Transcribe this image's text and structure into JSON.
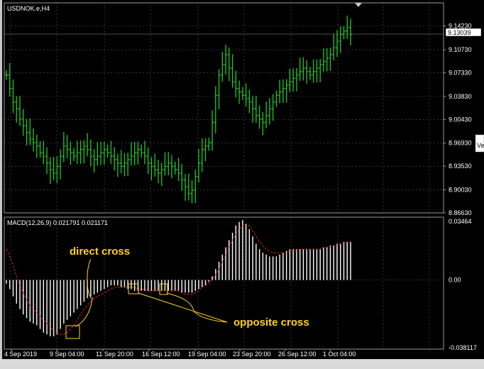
{
  "window": {
    "symbol_title": "USDNOK.e,H4",
    "indicator_title": "MACD(12,26,9) 0.021791 0.021171",
    "side_tab": "Ve"
  },
  "price_axis": {
    "labels": [
      "9.14230",
      "9.10730",
      "9.07330",
      "9.03830",
      "9.00430",
      "8.96930",
      "8.93530",
      "8.90030",
      "8.86630"
    ],
    "current_price": "9.13039"
  },
  "macd_axis": {
    "labels": [
      "0.03464",
      "0.00",
      "-0.038117"
    ]
  },
  "time_axis": {
    "labels": [
      "4 Sep 2019",
      "9 Sep 04:00",
      "11 Sep 20:00",
      "16 Sep 12:00",
      "19 Sep 04:00",
      "23 Sep 20:00",
      "26 Sep 12:00",
      "1 Oct 04:00"
    ]
  },
  "annotations": {
    "direct_cross": "direct cross",
    "opposite_cross": "opposite cross"
  },
  "colors": {
    "background": "#000000",
    "bars": "#22c72a",
    "histogram": "#ffffff",
    "signal": "#e02020",
    "annotation": "#ffd21a",
    "grid": "#555555"
  },
  "chart_data": [
    {
      "type": "ohlc",
      "title": "USDNOK.e,H4",
      "ylim": [
        8.8663,
        9.1765
      ],
      "x": [
        "4 Sep 2019",
        "9 Sep 04:00",
        "11 Sep 20:00",
        "16 Sep 12:00",
        "19 Sep 04:00",
        "23 Sep 20:00",
        "26 Sep 12:00",
        "1 Oct 04:00"
      ],
      "closes": [
        9.07,
        9.05,
        9.03,
        9.02,
        9.005,
        8.995,
        8.985,
        8.975,
        8.97,
        8.965,
        8.955,
        8.95,
        8.94,
        8.93,
        8.925,
        8.935,
        8.95,
        8.965,
        8.96,
        8.955,
        8.95,
        8.955,
        8.96,
        8.965,
        8.96,
        8.95,
        8.945,
        8.95,
        8.955,
        8.96,
        8.955,
        8.95,
        8.945,
        8.94,
        8.935,
        8.94,
        8.945,
        8.95,
        8.955,
        8.96,
        8.955,
        8.95,
        8.94,
        8.935,
        8.93,
        8.925,
        8.93,
        8.935,
        8.94,
        8.935,
        8.93,
        8.925,
        8.915,
        8.905,
        8.895,
        8.9,
        8.92,
        8.94,
        8.96,
        8.965,
        8.97,
        9.0,
        9.04,
        9.07,
        9.085,
        9.1,
        9.08,
        9.06,
        9.05,
        9.045,
        9.04,
        9.035,
        9.03,
        9.02,
        9.01,
        9.005,
        9.0,
        9.01,
        9.02,
        9.03,
        9.04,
        9.045,
        9.05,
        9.055,
        9.06,
        9.065,
        9.07,
        9.075,
        9.08,
        9.075,
        9.07,
        9.075,
        9.08,
        9.085,
        9.09,
        9.095,
        9.1,
        9.11,
        9.12,
        9.13,
        9.135,
        9.14,
        9.13
      ],
      "highs_delta": 0.018,
      "lows_delta": 0.018
    },
    {
      "type": "bar",
      "title": "MACD(12,26,9) 0.021791 0.021171",
      "ylim": [
        -0.038117,
        0.03464
      ],
      "series": [
        {
          "name": "MACD",
          "values": [
            -0.002,
            -0.005,
            -0.009,
            -0.013,
            -0.016,
            -0.019,
            -0.021,
            -0.023,
            -0.024,
            -0.025,
            -0.027,
            -0.029,
            -0.03,
            -0.031,
            -0.031,
            -0.03,
            -0.027,
            -0.024,
            -0.022,
            -0.02,
            -0.018,
            -0.016,
            -0.014,
            -0.012,
            -0.01,
            -0.009,
            -0.008,
            -0.007,
            -0.006,
            -0.005,
            -0.004,
            -0.003,
            -0.003,
            -0.003,
            -0.004,
            -0.004,
            -0.005,
            -0.005,
            -0.006,
            -0.006,
            -0.006,
            -0.006,
            -0.006,
            -0.006,
            -0.006,
            -0.006,
            -0.006,
            -0.006,
            -0.006,
            -0.006,
            -0.006,
            -0.006,
            -0.007,
            -0.007,
            -0.007,
            -0.007,
            -0.006,
            -0.005,
            -0.004,
            -0.003,
            -0.001,
            0.002,
            0.006,
            0.01,
            0.014,
            0.018,
            0.022,
            0.026,
            0.03,
            0.032,
            0.033,
            0.031,
            0.028,
            0.024,
            0.02,
            0.017,
            0.015,
            0.014,
            0.013,
            0.013,
            0.013,
            0.014,
            0.015,
            0.016,
            0.017,
            0.017,
            0.017,
            0.017,
            0.017,
            0.017,
            0.017,
            0.017,
            0.017,
            0.017,
            0.018,
            0.018,
            0.019,
            0.019,
            0.02,
            0.02,
            0.021,
            0.021,
            0.021
          ]
        },
        {
          "name": "Signal",
          "values": [
            0.017,
            0.013,
            0.008,
            0.002,
            -0.003,
            -0.007,
            -0.011,
            -0.014,
            -0.016,
            -0.018,
            -0.02,
            -0.022,
            -0.024,
            -0.026,
            -0.028,
            -0.029,
            -0.03,
            -0.03,
            -0.029,
            -0.027,
            -0.025,
            -0.022,
            -0.019,
            -0.016,
            -0.014,
            -0.012,
            -0.01,
            -0.009,
            -0.008,
            -0.007,
            -0.006,
            -0.005,
            -0.004,
            -0.004,
            -0.004,
            -0.004,
            -0.004,
            -0.004,
            -0.004,
            -0.005,
            -0.005,
            -0.005,
            -0.006,
            -0.006,
            -0.006,
            -0.006,
            -0.006,
            -0.006,
            -0.006,
            -0.006,
            -0.006,
            -0.006,
            -0.007,
            -0.008,
            -0.008,
            -0.008,
            -0.007,
            -0.006,
            -0.004,
            -0.003,
            -0.002,
            0.0,
            0.003,
            0.006,
            0.01,
            0.014,
            0.018,
            0.022,
            0.025,
            0.028,
            0.03,
            0.031,
            0.03,
            0.027,
            0.024,
            0.021,
            0.019,
            0.017,
            0.016,
            0.015,
            0.015,
            0.015,
            0.015,
            0.015,
            0.016,
            0.016,
            0.016,
            0.017,
            0.017,
            0.017,
            0.017,
            0.017,
            0.017,
            0.017,
            0.018,
            0.018,
            0.018,
            0.019,
            0.019,
            0.02,
            0.02,
            0.021,
            0.021
          ]
        }
      ]
    }
  ]
}
